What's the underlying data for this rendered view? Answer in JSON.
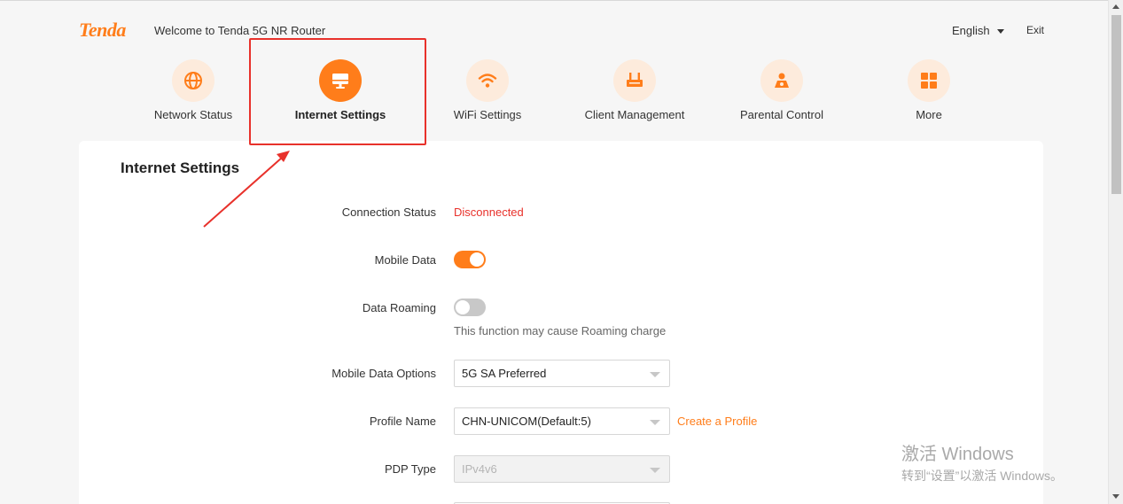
{
  "header": {
    "logo_text": "Tenda",
    "welcome": "Welcome to Tenda 5G NR Router",
    "language": "English",
    "exit": "Exit"
  },
  "nav": {
    "items": [
      {
        "label": "Network Status",
        "icon": "globe-icon"
      },
      {
        "label": "Internet Settings",
        "icon": "monitor-icon",
        "active": true
      },
      {
        "label": "WiFi Settings",
        "icon": "wifi-icon"
      },
      {
        "label": "Client Management",
        "icon": "router-icon"
      },
      {
        "label": "Parental Control",
        "icon": "parental-icon"
      },
      {
        "label": "More",
        "icon": "grid-icon"
      }
    ]
  },
  "page": {
    "title": "Internet Settings",
    "connection_status_label": "Connection Status",
    "connection_status_value": "Disconnected",
    "mobile_data_label": "Mobile Data",
    "mobile_data_on": true,
    "data_roaming_label": "Data Roaming",
    "data_roaming_on": false,
    "data_roaming_hint": "This function may cause Roaming charge",
    "mobile_data_options_label": "Mobile Data Options",
    "mobile_data_options_value": "5G SA Preferred",
    "profile_name_label": "Profile Name",
    "profile_name_value": "CHN-UNICOM(Default:5)",
    "create_profile_link": "Create a Profile",
    "pdp_type_label": "PDP Type",
    "pdp_type_value": "IPv4v6"
  },
  "watermark": {
    "line1": "激活 Windows",
    "line2": "转到“设置”以激活 Windows。"
  },
  "colors": {
    "accent": "#ff7d1a",
    "accent_light": "#fdebdc",
    "error": "#e8312b",
    "annotation": "#e8312b"
  }
}
